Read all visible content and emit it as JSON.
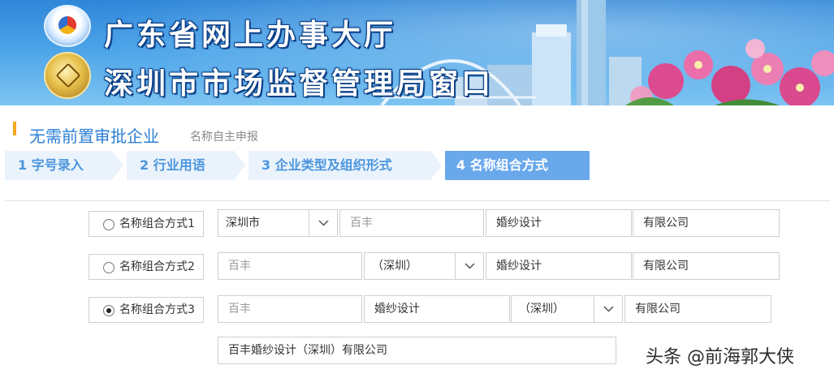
{
  "banner": {
    "title_line1": "广东省网上办事大厅",
    "title_line2": "深圳市市场监督管理局窗口",
    "emblem_top_text": "广东省网上办事大厅",
    "emblem_bottom_text": "深圳市市场监督管理局"
  },
  "section": {
    "title": "无需前置审批企业",
    "subtitle": "名称自主申报"
  },
  "steps": [
    {
      "label": "1 字号录入",
      "active": false
    },
    {
      "label": "2 行业用语",
      "active": false
    },
    {
      "label": "3 企业类型及组织形式",
      "active": false
    },
    {
      "label": "4 名称组合方式",
      "active": true
    }
  ],
  "options": [
    {
      "label": "名称组合方式1",
      "checked": false,
      "city_select": "深圳市",
      "brand": "百丰",
      "industry": "婚纱设计",
      "org_form": "有限公司"
    },
    {
      "label": "名称组合方式2",
      "checked": false,
      "brand": "百丰",
      "city_select": "（深圳）",
      "industry": "婚纱设计",
      "org_form": "有限公司"
    },
    {
      "label": "名称组合方式3",
      "checked": true,
      "brand": "百丰",
      "industry": "婚纱设计",
      "city_select": "（深圳）",
      "org_form": "有限公司"
    }
  ],
  "result_name": "百丰婚纱设计（深圳）有限公司",
  "watermark": "头条 @前海郭大侠",
  "colors": {
    "accent_blue": "#2d7fd6",
    "step_active": "#6aa8ec",
    "step_inactive": "#eaf3fb",
    "section_marker": "#f5a623"
  },
  "icons": {
    "select_caret": "chevron-down-icon",
    "radio": "radio-icon"
  }
}
